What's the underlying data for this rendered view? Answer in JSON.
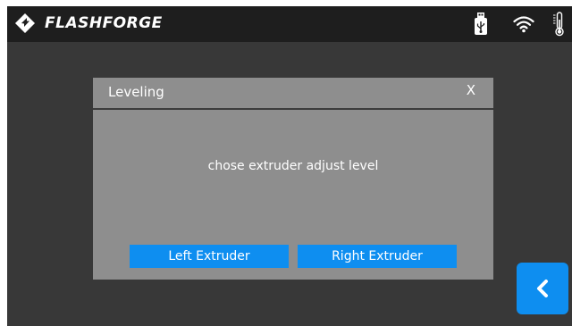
{
  "header": {
    "brand": "FLASHFORGE",
    "icons": [
      "flashforge-logo-icon",
      "usb-icon",
      "wifi-icon",
      "thermometer-icon"
    ]
  },
  "dialog": {
    "title": "Leveling",
    "close_label": "X",
    "message": "chose extruder adjust level",
    "left_button_label": "Left Extruder",
    "right_button_label": "Right Extruder"
  },
  "nav": {
    "back_icon": "chevron-left-icon"
  },
  "colors": {
    "topbar": "#1e1e1e",
    "screen_background": "#383838",
    "dialog_background": "#8e8e8e",
    "accent_blue": "#0e8ef0"
  }
}
